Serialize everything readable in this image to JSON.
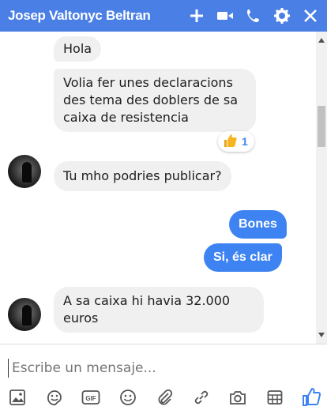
{
  "header": {
    "title": "Josep Valtonyc Beltran",
    "icons": [
      "plus-icon",
      "video-icon",
      "phone-icon",
      "gear-icon",
      "close-icon"
    ]
  },
  "messages": [
    {
      "from": "contact",
      "text": "Hola"
    },
    {
      "from": "contact",
      "lines": [
        "Volia fer unes declaracions",
        "des tema des doblers de sa",
        "caixa de resistencia"
      ]
    },
    {
      "from": "contact",
      "text": "Tu mho podries publicar?"
    },
    {
      "from": "me",
      "text": "Bones"
    },
    {
      "from": "me",
      "text": "Si, és clar"
    },
    {
      "from": "contact",
      "lines": [
        "A sa caixa hi havia 32.000",
        "euros"
      ]
    }
  ],
  "reaction": {
    "icon": "thumbs-up-icon",
    "count": "1"
  },
  "composer": {
    "placeholder": "Escribe un mensaje...",
    "tools": [
      "image-icon",
      "sticker-icon",
      "gif-icon",
      "emoji-icon",
      "attachment-icon",
      "link-icon",
      "camera-icon",
      "table-icon",
      "like-icon"
    ]
  },
  "colors": {
    "accent": "#4a7fe6",
    "bubble_out": "#3d83f2",
    "bubble_in": "#f1f0f0"
  }
}
